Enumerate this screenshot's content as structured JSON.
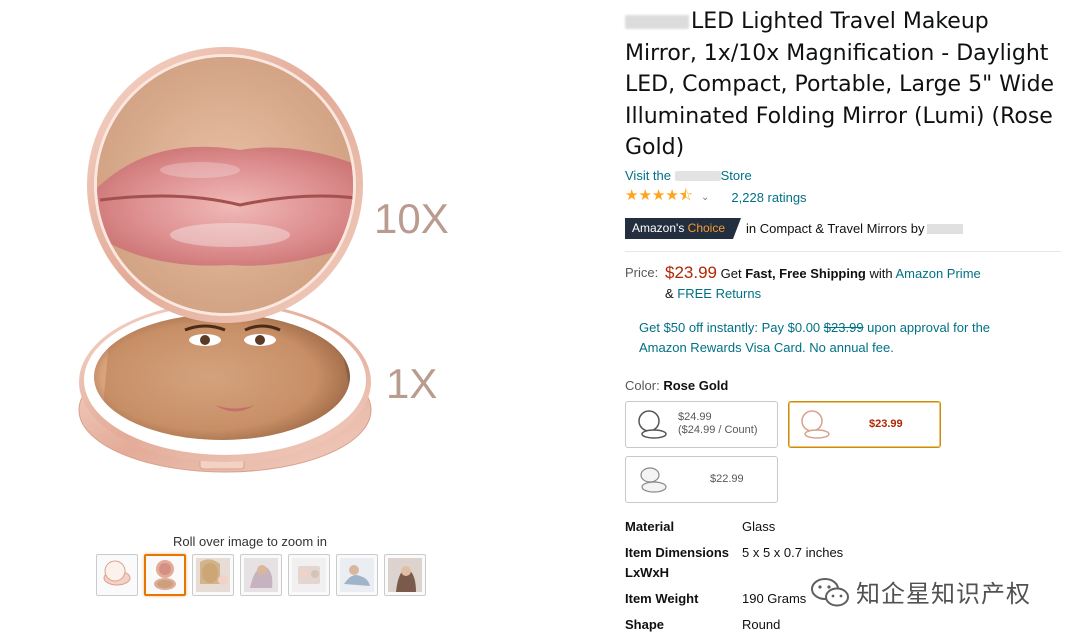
{
  "gallery": {
    "zoom_hint": "Roll over image to zoom in",
    "magnification_top": "10X",
    "magnification_bottom": "1X",
    "thumbnails": [
      "thumb-mirror-closed",
      "thumb-mirror-open",
      "thumb-lifestyle-1",
      "thumb-lifestyle-2",
      "thumb-lifestyle-3",
      "thumb-lifestyle-4",
      "thumb-lifestyle-5"
    ],
    "active_thumbnail": 1
  },
  "product": {
    "title": "LED Lighted Travel Makeup Mirror, 1x/10x Magnification - Daylight LED, Compact, Portable, Large 5\" Wide Illuminated Folding Mirror (Lumi) (Rose Gold)",
    "store_prefix": "Visit the",
    "store_suffix": "Store",
    "stars_value": 4.5,
    "stars_glyphs": "★★★★⯪",
    "ratings_text": "2,228 ratings",
    "badge_part1": "Amazon's",
    "badge_part2": "Choice",
    "badge_context": "in Compact & Travel Mirrors by"
  },
  "pricing": {
    "label": "Price:",
    "price": "$23.99",
    "shipping_get": "Get",
    "shipping_bold": "Fast, Free Shipping",
    "shipping_with": "with",
    "prime_link": "Amazon Prime",
    "returns_amp": "&",
    "returns_link": "FREE Returns",
    "promo_line1_a": "Get $50 off instantly: Pay $0.00",
    "promo_strike": "$23.99",
    "promo_line1_b": "upon approval for the",
    "promo_line2": "Amazon Rewards Visa Card. No annual fee."
  },
  "color": {
    "label": "Color:",
    "value": "Rose Gold",
    "options": [
      {
        "price": "$24.99",
        "unit": "($24.99 / Count)"
      },
      {
        "price": "$23.99"
      },
      {
        "price": "$22.99"
      }
    ],
    "selected_index": 1
  },
  "specs": [
    {
      "key": "Material",
      "value": "Glass"
    },
    {
      "key": "Item Dimensions LxWxH",
      "value": "5 x 5 x 0.7 inches"
    },
    {
      "key": "Item Weight",
      "value": "190 Grams"
    },
    {
      "key": "Shape",
      "value": "Round"
    }
  ],
  "watermark": {
    "text": "知企星知识产权"
  },
  "colors": {
    "link": "#007185",
    "price": "#b12704",
    "star": "#ffa41c",
    "badge_bg": "#232f3e",
    "badge_orange": "#f69931",
    "rose_gold": "#e8b7a6"
  }
}
